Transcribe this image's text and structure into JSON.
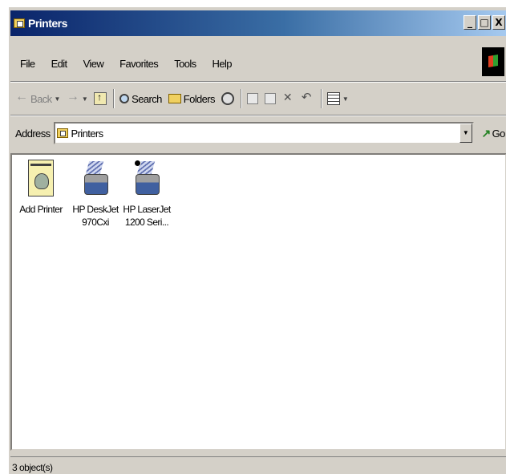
{
  "window": {
    "title": "Printers",
    "buttons": {
      "minimize": "_",
      "maximize": "□",
      "close": "X"
    }
  },
  "menubar": {
    "items": [
      "File",
      "Edit",
      "View",
      "Favorites",
      "Tools",
      "Help"
    ]
  },
  "toolbar": {
    "back": "Back",
    "search": "Search",
    "folders": "Folders"
  },
  "address": {
    "label": "Address",
    "value": "Printers",
    "go": "Go"
  },
  "items": [
    {
      "label": "Add Printer",
      "icon": "add-printer-icon"
    },
    {
      "label": "HP DeskJet 970Cxi",
      "icon": "printer-icon"
    },
    {
      "label": "HP LaserJet 1200 Seri...",
      "icon": "printer-icon",
      "default": true
    }
  ],
  "statusbar": {
    "text": "3 object(s)"
  }
}
